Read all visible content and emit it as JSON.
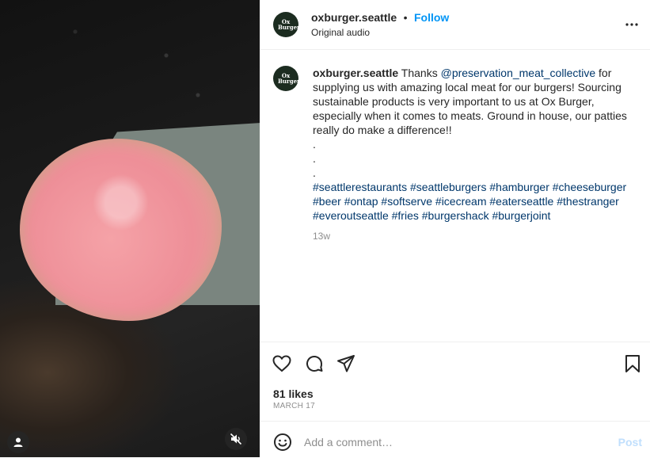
{
  "post": {
    "username": "oxburger.seattle",
    "separator": "•",
    "follow_label": "Follow",
    "audio_label": "Original audio",
    "avatar_text": "Ox Burger",
    "caption": {
      "username": "oxburger.seattle",
      "pre_mention": "Thanks ",
      "mention": "@preservation_meat_collective",
      "body": " for supplying us with amazing local meat for our burgers! Sourcing sustainable products is very important to us at Ox Burger, especially when it comes to meats. Ground in house, our patties really do make a difference!!",
      "dots": [
        ".",
        ".",
        "."
      ],
      "hashtags": [
        "#seattlerestaurants",
        "#seattleburgers",
        "#hamburger",
        "#cheeseburger",
        "#beer",
        "#ontap",
        "#softserve",
        "#icecream",
        "#eaterseattle",
        "#thestranger",
        "#everoutseattle",
        "#fries",
        "#burgershack",
        "#burgerjoint"
      ]
    },
    "age": "13w",
    "likes": "81 likes",
    "date": "MARCH 17",
    "comment_placeholder": "Add a comment…",
    "post_label": "Post"
  },
  "icons": {
    "more": "more-options-icon",
    "heart": "heart-icon",
    "comment": "comment-icon",
    "share": "share-icon",
    "save": "bookmark-icon",
    "emoji": "emoji-icon",
    "user": "user-icon",
    "mute": "muted-audio-icon"
  },
  "colors": {
    "follow": "#0095f6",
    "link": "#00376b",
    "muted_text": "#8e8e8e",
    "post_disabled": "#c0dffd"
  }
}
